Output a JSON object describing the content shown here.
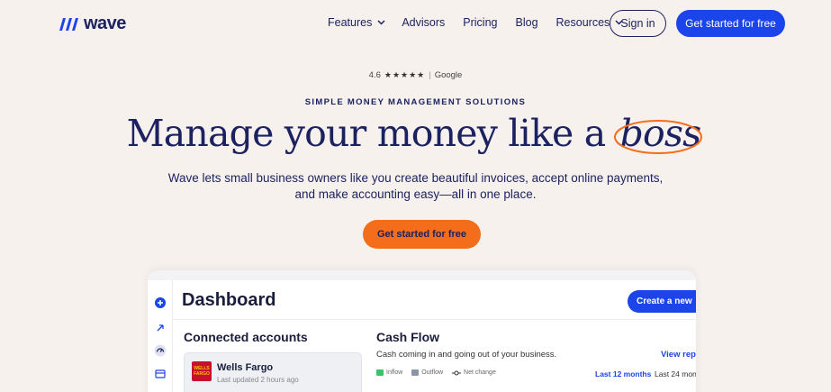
{
  "colors": {
    "background": "#f7f1ee",
    "navy": "#1c2260",
    "primary_blue": "#1b44ea",
    "orange": "#f36d1b",
    "inflow": "#3ac36a",
    "outflow": "#8a96a8"
  },
  "nav": {
    "logo_text": "wave",
    "links": [
      {
        "label": "Features",
        "has_dropdown": true
      },
      {
        "label": "Advisors",
        "has_dropdown": false
      },
      {
        "label": "Pricing",
        "has_dropdown": false
      },
      {
        "label": "Blog",
        "has_dropdown": false
      },
      {
        "label": "Resources",
        "has_dropdown": true
      }
    ],
    "signin_label": "Sign in",
    "cta_label": "Get started for free"
  },
  "hero": {
    "rating_value": "4.6",
    "rating_stars": "★★★★★",
    "rating_source": "Google",
    "eyebrow": "SIMPLE MONEY MANAGEMENT SOLUTIONS",
    "headline_main": "Manage your money like a",
    "headline_emphasis": "boss",
    "subtext_line1": "Wave lets small business owners like you create beautiful invoices, accept online payments,",
    "subtext_line2": "and make accounting easy—all in one place.",
    "cta_label": "Get started for free"
  },
  "dashboard": {
    "title": "Dashboard",
    "create_button": "Create a new",
    "connected_accounts_title": "Connected accounts",
    "account": {
      "logo_text": "WELLS FARGO",
      "name": "Wells Fargo",
      "updated": "Last updated 2 hours ago"
    },
    "cash_flow": {
      "title": "Cash Flow",
      "subtitle": "Cash coming in and going out of your business.",
      "view_link": "View repo",
      "legend": [
        "Inflow",
        "Outflow",
        "Net change"
      ],
      "range_selected": "Last 12 months",
      "range_other": "Last 24 mon"
    },
    "rail_icons": [
      "plus-icon",
      "rocket-icon",
      "dashboard-icon",
      "invoice-icon"
    ]
  }
}
